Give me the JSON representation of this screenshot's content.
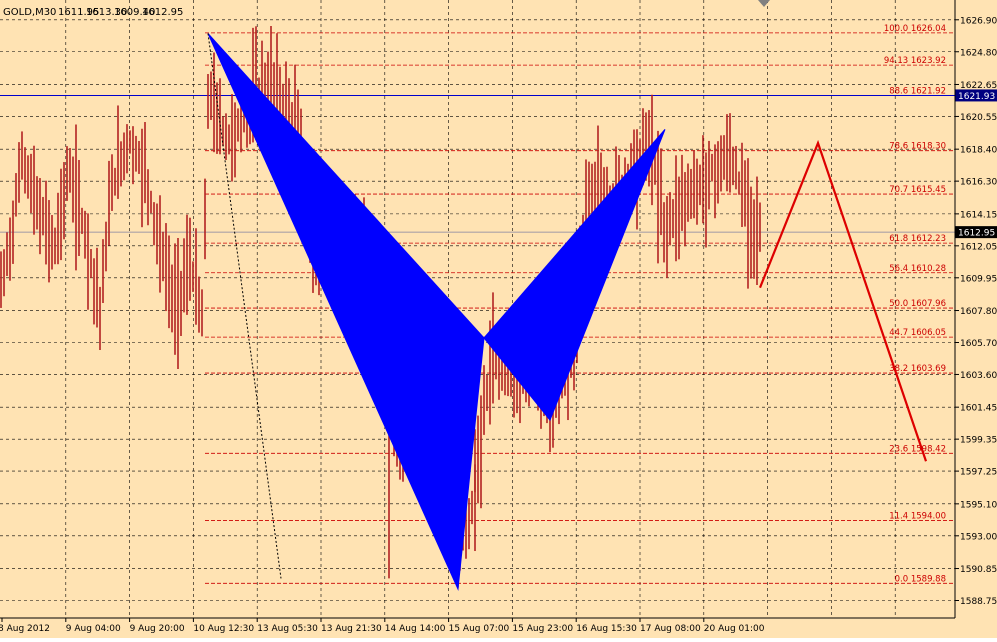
{
  "header": {
    "symbol": "GOLD,M30",
    "open": "1611.95",
    "high": "1613.30",
    "low": "1609.40",
    "close": "1612.95"
  },
  "colors": {
    "background": "#FFE3B3",
    "grid": "#000000",
    "candles": "#B22222",
    "pattern_fill": "#0000FF",
    "fib_lines": "#CC0000",
    "projection": "#DD0000",
    "hline": "#0000CC",
    "price_label_bg": "#000080",
    "axis_text": "#000000"
  },
  "chart_data": {
    "type": "candlestick",
    "title": "",
    "ylim": [
      1587.6,
      1628.2
    ],
    "price_axis_labels": [
      1626.9,
      1624.8,
      1622.65,
      1620.55,
      1618.4,
      1616.3,
      1614.15,
      1612.05,
      1609.95,
      1607.8,
      1605.7,
      1603.6,
      1601.45,
      1599.35,
      1597.25,
      1595.1,
      1593.0,
      1590.85,
      1588.75
    ],
    "time_axis_labels": [
      "8 Aug 2012",
      "9 Aug 04:00",
      "9 Aug 20:00",
      "10 Aug 12:30",
      "13 Aug 05:30",
      "13 Aug 21:30",
      "14 Aug 14:00",
      "15 Aug 07:00",
      "15 Aug 23:00",
      "16 Aug 15:30",
      "17 Aug 08:00",
      "20 Aug 01:00"
    ],
    "fibonacci_levels": [
      {
        "ratio": "100.0",
        "price": "1626.04"
      },
      {
        "ratio": "94.13",
        "price": "1623.92"
      },
      {
        "ratio": "88.6",
        "price": "1621.92"
      },
      {
        "ratio": "78.6",
        "price": "1618.30"
      },
      {
        "ratio": "70.7",
        "price": "1615.45"
      },
      {
        "ratio": "61.8",
        "price": "1612.23"
      },
      {
        "ratio": "56.4",
        "price": "1610.28"
      },
      {
        "ratio": "50.0",
        "price": "1607.96"
      },
      {
        "ratio": "44.7",
        "price": "1606.05"
      },
      {
        "ratio": "38.2",
        "price": "1603.69"
      },
      {
        "ratio": "23.6",
        "price": "1598.42"
      },
      {
        "ratio": "11.4",
        "price": "1594.00"
      },
      {
        "ratio": "0.0",
        "price": "1589.88"
      }
    ],
    "horizontal_line": {
      "price": 1621.93,
      "label": "1621.93"
    },
    "current_price": {
      "price": 1612.95,
      "label": "1612.95"
    },
    "butterfly_pattern": {
      "X": {
        "bar": 208,
        "price": 1626.0
      },
      "A": {
        "bar": 458,
        "price": 1589.5
      },
      "B": {
        "bar": 484,
        "price": 1606.0
      },
      "C": {
        "bar": 550,
        "price": 1600.6
      },
      "D": {
        "bar": 665,
        "price": 1619.7
      }
    },
    "projection_path": [
      {
        "bar": 760,
        "price": 1609.3
      },
      {
        "bar": 818,
        "price": 1618.8
      },
      {
        "bar": 926,
        "price": 1597.9
      }
    ],
    "dotted_line": [
      {
        "bar": 208,
        "price": 1626.0
      },
      {
        "bar": 281,
        "price": 1590.2
      }
    ],
    "price_path": [
      [
        0,
        1609
      ],
      [
        12,
        1613
      ],
      [
        22,
        1618
      ],
      [
        40,
        1614
      ],
      [
        55,
        1612
      ],
      [
        68,
        1617
      ],
      [
        85,
        1613
      ],
      [
        100,
        1608
      ],
      [
        112,
        1616
      ],
      [
        128,
        1619
      ],
      [
        145,
        1617
      ],
      [
        160,
        1612
      ],
      [
        175,
        1608
      ],
      [
        190,
        1611
      ],
      [
        203,
        1607
      ],
      [
        208,
        1622
      ],
      [
        215,
        1621
      ],
      [
        228,
        1619
      ],
      [
        242,
        1620
      ],
      [
        255,
        1622
      ],
      [
        270,
        1623
      ],
      [
        288,
        1621
      ],
      [
        300,
        1619
      ],
      [
        312,
        1611
      ],
      [
        328,
        1612
      ],
      [
        345,
        1611
      ],
      [
        362,
        1613
      ],
      [
        375,
        1612
      ],
      [
        385,
        1606
      ],
      [
        392,
        1600
      ],
      [
        405,
        1599
      ],
      [
        420,
        1602
      ],
      [
        440,
        1600
      ],
      [
        458,
        1592
      ],
      [
        470,
        1594
      ],
      [
        478,
        1598
      ],
      [
        490,
        1604
      ],
      [
        505,
        1605
      ],
      [
        520,
        1604
      ],
      [
        535,
        1603
      ],
      [
        550,
        1601
      ],
      [
        565,
        1604
      ],
      [
        578,
        1607
      ],
      [
        585,
        1615
      ],
      [
        600,
        1616
      ],
      [
        615,
        1615
      ],
      [
        630,
        1617
      ],
      [
        650,
        1619
      ],
      [
        665,
        1613
      ],
      [
        680,
        1615
      ],
      [
        700,
        1616
      ],
      [
        715,
        1617
      ],
      [
        730,
        1618
      ],
      [
        740,
        1616
      ],
      [
        750,
        1614
      ],
      [
        760,
        1613
      ]
    ]
  }
}
